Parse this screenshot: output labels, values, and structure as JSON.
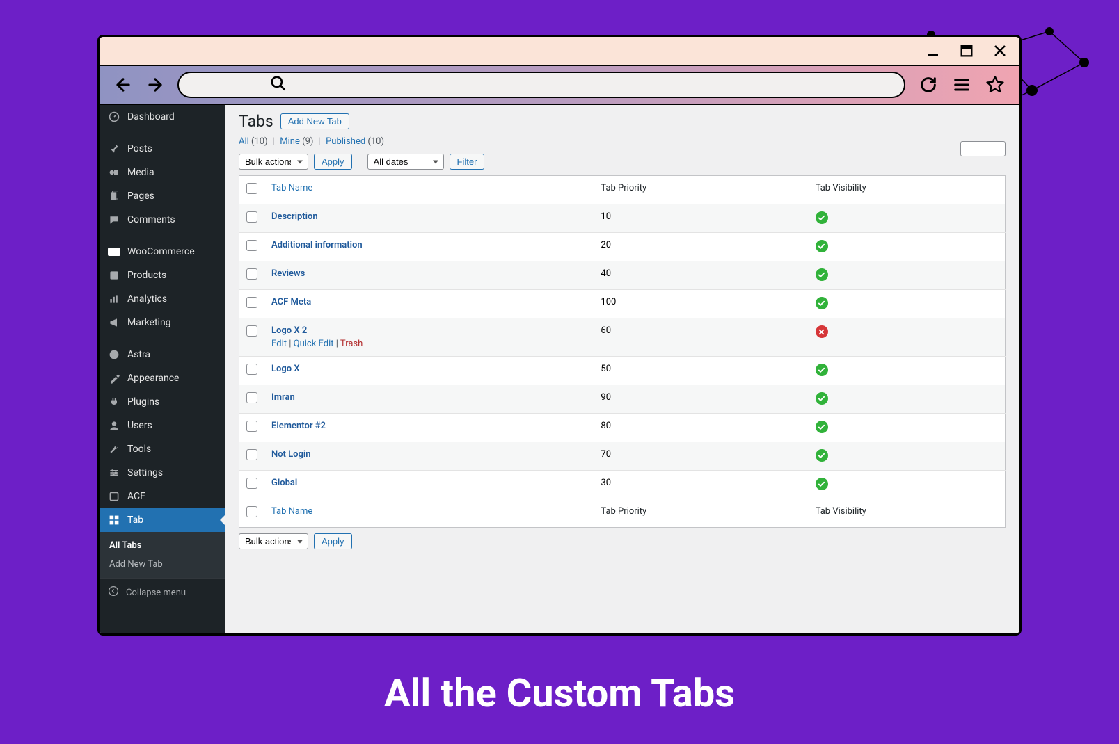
{
  "caption": "All the Custom Tabs",
  "browser": {
    "search_placeholder": ""
  },
  "sidebar": {
    "items": [
      {
        "label": "Dashboard",
        "icon": "dashboard"
      },
      {
        "label": "Posts",
        "icon": "pin"
      },
      {
        "label": "Media",
        "icon": "media"
      },
      {
        "label": "Pages",
        "icon": "pages"
      },
      {
        "label": "Comments",
        "icon": "comments"
      },
      {
        "label": "WooCommerce",
        "icon": "woo"
      },
      {
        "label": "Products",
        "icon": "products"
      },
      {
        "label": "Analytics",
        "icon": "analytics"
      },
      {
        "label": "Marketing",
        "icon": "marketing"
      },
      {
        "label": "Astra",
        "icon": "astra"
      },
      {
        "label": "Appearance",
        "icon": "appearance"
      },
      {
        "label": "Plugins",
        "icon": "plugins"
      },
      {
        "label": "Users",
        "icon": "users"
      },
      {
        "label": "Tools",
        "icon": "tools"
      },
      {
        "label": "Settings",
        "icon": "settings"
      },
      {
        "label": "ACF",
        "icon": "acf"
      },
      {
        "label": "Tab",
        "icon": "tab",
        "active": true
      }
    ],
    "submenu": {
      "current": "All Tabs",
      "other": "Add New Tab"
    },
    "collapse": "Collapse menu"
  },
  "page": {
    "title": "Tabs",
    "add_label": "Add New Tab",
    "filters": {
      "all_label": "All",
      "all_count": "(10)",
      "mine_label": "Mine",
      "mine_count": "(9)",
      "published_label": "Published",
      "published_count": "(10)"
    },
    "bulk": {
      "label": "Bulk actions",
      "apply": "Apply"
    },
    "date_filter": {
      "label": "All dates",
      "filter": "Filter"
    },
    "columns": {
      "name": "Tab Name",
      "priority": "Tab Priority",
      "visibility": "Tab Visibility"
    },
    "row_actions": {
      "edit": "Edit",
      "quick": "Quick Edit",
      "trash": "Trash"
    },
    "rows": [
      {
        "name": "Description",
        "priority": "10",
        "ok": true
      },
      {
        "name": "Additional information",
        "priority": "20",
        "ok": true
      },
      {
        "name": "Reviews",
        "priority": "40",
        "ok": true
      },
      {
        "name": "ACF Meta",
        "priority": "100",
        "ok": true
      },
      {
        "name": "Logo X 2",
        "priority": "60",
        "ok": false,
        "actions": true
      },
      {
        "name": "Logo X",
        "priority": "50",
        "ok": true
      },
      {
        "name": "Imran",
        "priority": "90",
        "ok": true
      },
      {
        "name": "Elementor #2",
        "priority": "80",
        "ok": true
      },
      {
        "name": "Not Login",
        "priority": "70",
        "ok": true
      },
      {
        "name": "Global",
        "priority": "30",
        "ok": true
      }
    ]
  }
}
